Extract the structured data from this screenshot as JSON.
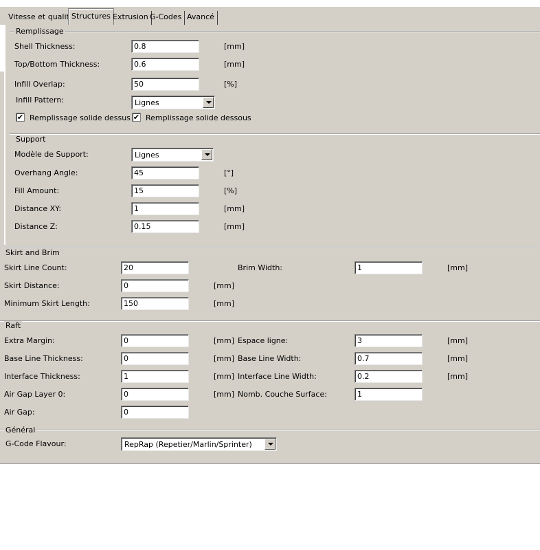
{
  "tabs": [
    {
      "label": "Vitesse et qualité"
    },
    {
      "label": "Structures"
    },
    {
      "label": "Extrusion"
    },
    {
      "label": "G-Codes"
    },
    {
      "label": "Avancé"
    }
  ],
  "remplissage": {
    "title": "Remplissage",
    "shell_thickness": {
      "label": "Shell Thickness:",
      "value": "0.8",
      "unit": "[mm]"
    },
    "top_bottom_thickness": {
      "label": "Top/Bottom Thickness:",
      "value": "0.6",
      "unit": "[mm]"
    },
    "infill_overlap": {
      "label": "Infill Overlap:",
      "value": "50",
      "unit": "[%]"
    },
    "infill_pattern": {
      "label": "Infill Pattern:",
      "value": "Lignes"
    },
    "solid_top": {
      "label": "Remplissage solide dessus",
      "checked": true,
      "mark": "✔"
    },
    "solid_bottom": {
      "label": "Remplissage solide dessous",
      "checked": true,
      "mark": "✔"
    }
  },
  "support": {
    "title": "Support",
    "support_type": {
      "label": "Modèle de Support:",
      "value": "Lignes"
    },
    "overhang_angle": {
      "label": "Overhang Angle:",
      "value": "45",
      "unit": "[°]"
    },
    "fill_amount": {
      "label": "Fill Amount:",
      "value": "15",
      "unit": "[%]"
    },
    "distance_xy": {
      "label": "Distance XY:",
      "value": "1",
      "unit": "[mm]"
    },
    "distance_z": {
      "label": "Distance Z:",
      "value": "0.15",
      "unit": "[mm]"
    }
  },
  "skirt": {
    "title": "Skirt and Brim",
    "line_count": {
      "label": "Skirt Line Count:",
      "value": "20"
    },
    "brim_width": {
      "label": "Brim Width:",
      "value": "1",
      "unit": "[mm]"
    },
    "distance": {
      "label": "Skirt Distance:",
      "value": "0",
      "unit": "[mm]"
    },
    "min_length": {
      "label": "Minimum Skirt Length:",
      "value": "150",
      "unit": "[mm]"
    }
  },
  "raft": {
    "title": "Raft",
    "extra_margin": {
      "label": "Extra Margin:",
      "value": "0",
      "unit": "[mm]"
    },
    "line_spacing": {
      "label": "Espace ligne:",
      "value": "3",
      "unit": "[mm]"
    },
    "base_thickness": {
      "label": "Base Line Thickness:",
      "value": "0",
      "unit": "[mm]"
    },
    "base_width": {
      "label": "Base Line Width:",
      "value": "0.7",
      "unit": "[mm]"
    },
    "interface_thickness": {
      "label": "Interface Thickness:",
      "value": "1",
      "unit": "[mm]"
    },
    "interface_width": {
      "label": "Interface Line Width:",
      "value": "0.2",
      "unit": "[mm]"
    },
    "air_gap_layer0": {
      "label": "Air Gap Layer 0:",
      "value": "0",
      "unit": "[mm]"
    },
    "surface_layers": {
      "label": "Nomb. Couche Surface:",
      "value": "1"
    },
    "air_gap": {
      "label": "Air Gap:",
      "value": "0"
    }
  },
  "general": {
    "title": "Général",
    "gcode_flavour": {
      "label": "G-Code Flavour:",
      "value": "RepRap (Repetier/Marlin/Sprinter)"
    }
  }
}
